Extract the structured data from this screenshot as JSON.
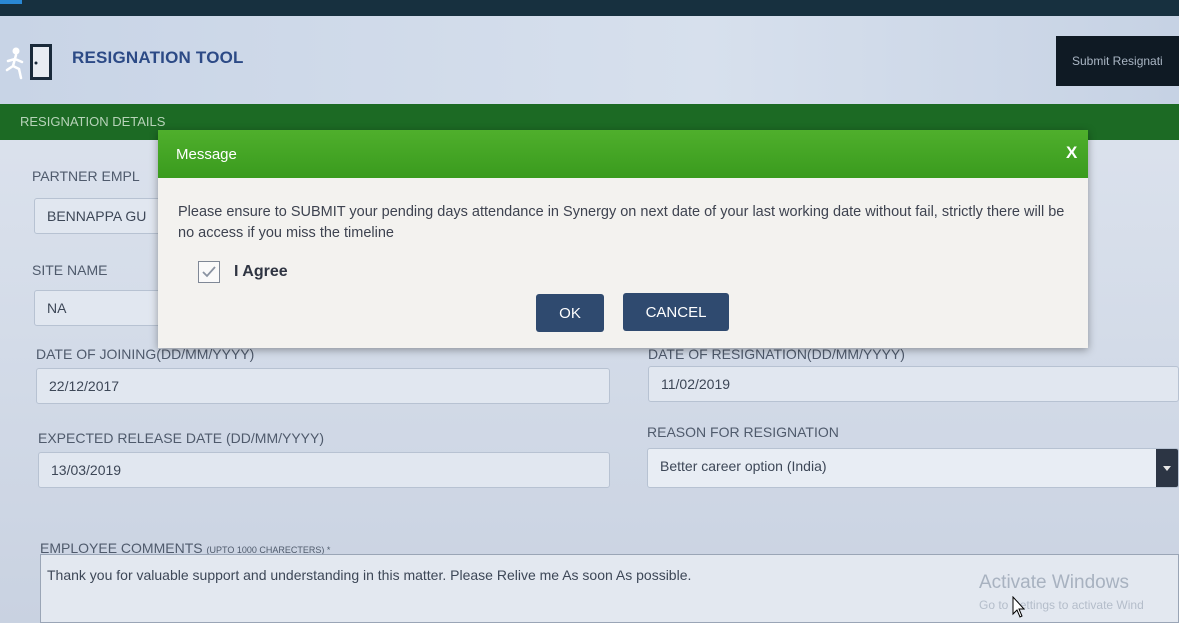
{
  "app": {
    "title": "RESIGNATION TOOL",
    "submit_label": "Submit Resignati",
    "section_title": "RESIGNATION DETAILS"
  },
  "form": {
    "partner_label": "PARTNER EMPL",
    "partner_value": "BENNAPPA GU",
    "site_label": "SITE NAME",
    "site_value": "NA",
    "doj_label": "DATE OF JOINING(DD/MM/YYYY)",
    "doj_value": "22/12/2017",
    "dor_label": "DATE OF RESIGNATION(DD/MM/YYYY)",
    "dor_value": "11/02/2019",
    "release_label": "EXPECTED RELEASE DATE (DD/MM/YYYY)",
    "release_value": "13/03/2019",
    "reason_label": "REASON FOR RESIGNATION",
    "reason_value": "Better career option (India)",
    "comments_label": "EMPLOYEE COMMENTS",
    "comments_note": "(UPTO 1000 CHARECTERS) *",
    "comments_value": "Thank you for valuable support and understanding in this matter. Please Relive me As soon As possible."
  },
  "modal": {
    "title": "Message",
    "close": "X",
    "message": "Please ensure to SUBMIT your pending days attendance in Synergy on next date of your last working date without fail, strictly there will be no access if you miss the timeline",
    "agree_label": "I Agree",
    "agree_checked": true,
    "ok_label": "OK",
    "cancel_label": "CANCEL"
  },
  "watermark": {
    "title": "Activate Windows",
    "subtitle": "Go to Settings to activate Wind"
  },
  "colors": {
    "header_green": "#3a9b1e",
    "section_green": "#1c6a24",
    "button_navy": "#2f4a6f",
    "title_blue": "#2c4a86"
  }
}
